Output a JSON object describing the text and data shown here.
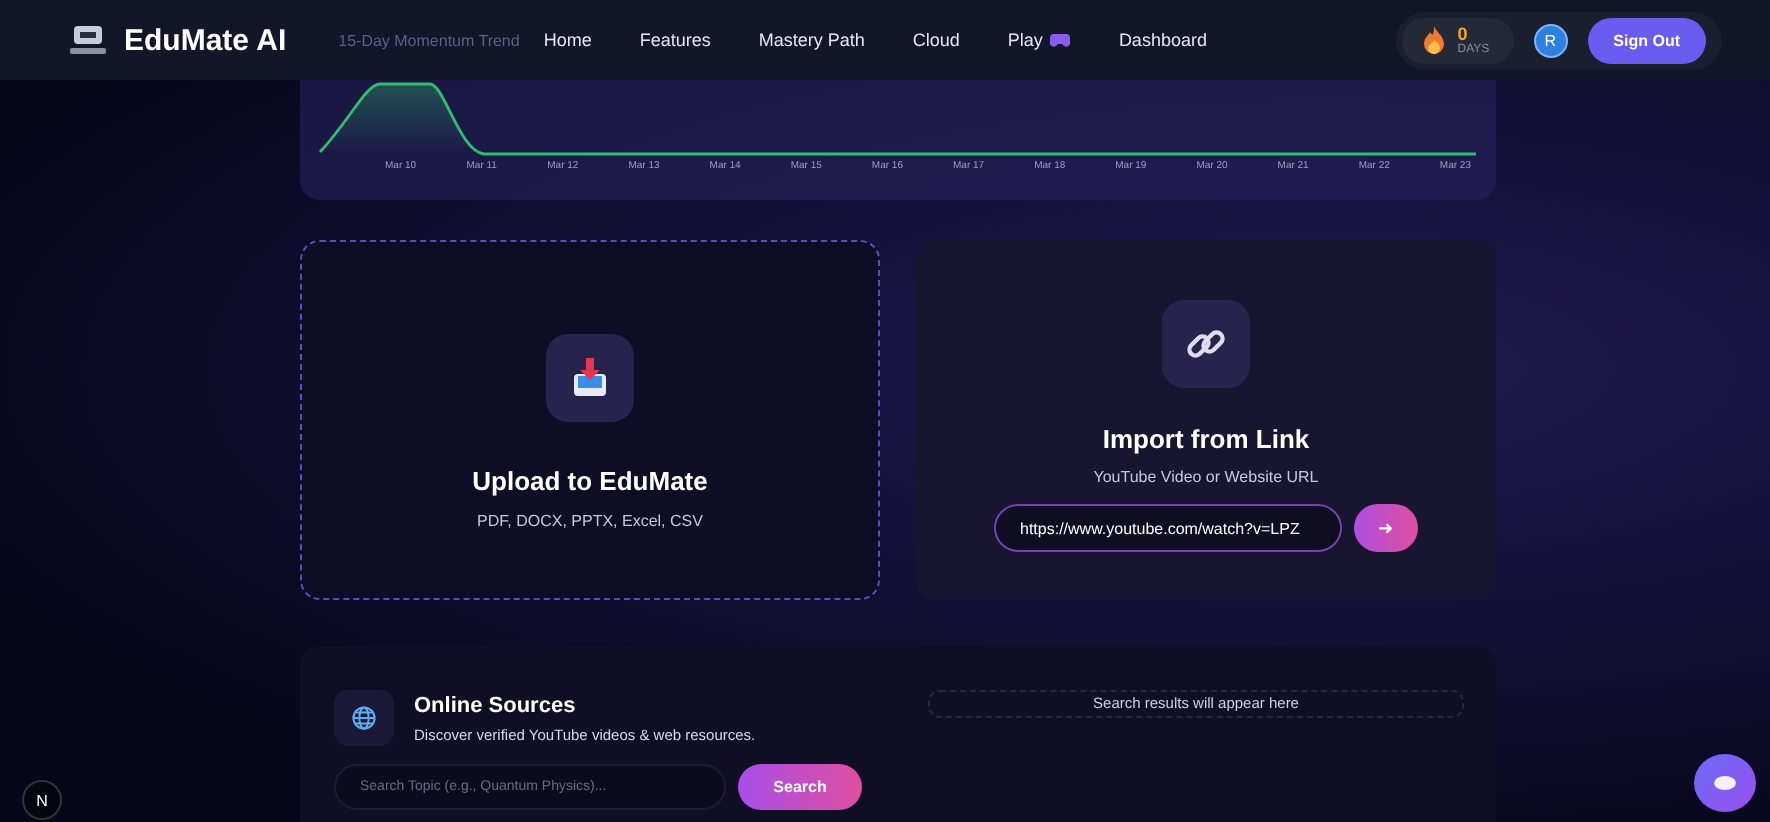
{
  "header": {
    "logo": "EduMate AI",
    "chart_title": "15-Day Momentum Trend",
    "nav": [
      {
        "label": "Home",
        "kind": "text"
      },
      {
        "label": "Features",
        "kind": "text"
      },
      {
        "label": "Mastery Path",
        "kind": "text"
      },
      {
        "label": "Cloud",
        "kind": "text"
      },
      {
        "label": "Play",
        "kind": "game"
      },
      {
        "label": "Dashboard",
        "kind": "text"
      }
    ],
    "streak": {
      "count": "0",
      "unit": "DAYS"
    },
    "avatar": "R",
    "sign_out": "Sign Out"
  },
  "chart": {
    "x_labels": [
      "Mar 10",
      "Mar 11",
      "Mar 12",
      "Mar 13",
      "Mar 14",
      "Mar 15",
      "Mar 16",
      "Mar 17",
      "Mar 18",
      "Mar 19",
      "Mar 20",
      "Mar 21",
      "Mar 22",
      "Mar 23"
    ]
  },
  "upload": {
    "title": "Upload to EduMate",
    "formats": "PDF, DOCX, PPTX, Excel, CSV"
  },
  "import": {
    "title": "Import from Link",
    "subtitle": "YouTube Video or Website URL",
    "url": "https://www.youtube.com/watch?v=LPZ",
    "submit": "➜"
  },
  "online": {
    "title": "Online Sources",
    "description": "Discover verified YouTube videos & web resources.",
    "placeholder": "Search Topic (e.g., Quantum Physics)...",
    "button": "Search",
    "results": "Search results will appear here"
  },
  "corner_badge": "N"
}
